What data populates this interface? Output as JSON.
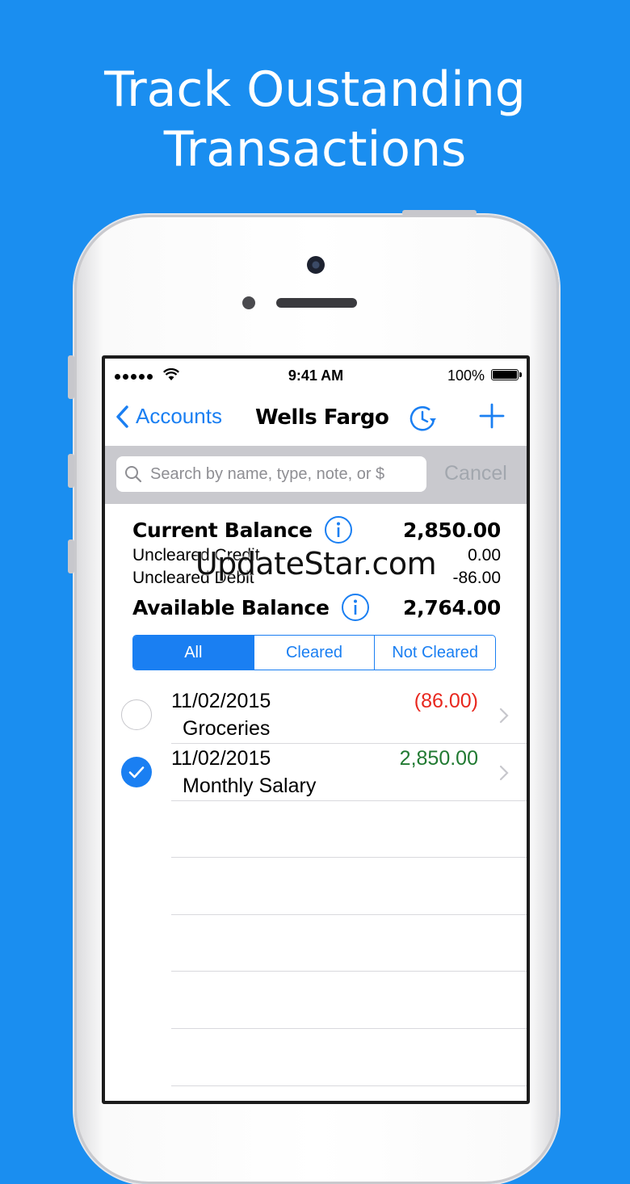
{
  "headline": {
    "line1": "Track Oustanding",
    "line2": "Transactions"
  },
  "status": {
    "time": "9:41 AM",
    "battery": "100%"
  },
  "nav": {
    "back_label": "Accounts",
    "title": "Wells Fargo"
  },
  "search": {
    "placeholder": "Search by name, type, note, or $",
    "cancel_label": "Cancel"
  },
  "balances": {
    "current_label": "Current Balance",
    "current_value": "2,850.00",
    "uncleared_credit_label": "Uncleared Credit",
    "uncleared_credit_value": "0.00",
    "uncleared_debit_label": "Uncleared Debit",
    "uncleared_debit_value": "-86.00",
    "available_label": "Available Balance",
    "available_value": "2,764.00"
  },
  "segments": {
    "all": "All",
    "cleared": "Cleared",
    "not_cleared": "Not Cleared",
    "selected": "All"
  },
  "transactions": [
    {
      "date": "11/02/2015",
      "name": "Groceries",
      "amount": "(86.00)",
      "cleared": false,
      "amount_color": "#e8281f"
    },
    {
      "date": "11/02/2015",
      "name": "Monthly Salary",
      "amount": "2,850.00",
      "cleared": true,
      "amount_color": "#217a32"
    }
  ],
  "watermark": "UpdateStar.com",
  "colors": {
    "background": "#1a8ef0",
    "accent": "#1a7ff2",
    "debit": "#e8281f",
    "credit": "#217a32"
  }
}
